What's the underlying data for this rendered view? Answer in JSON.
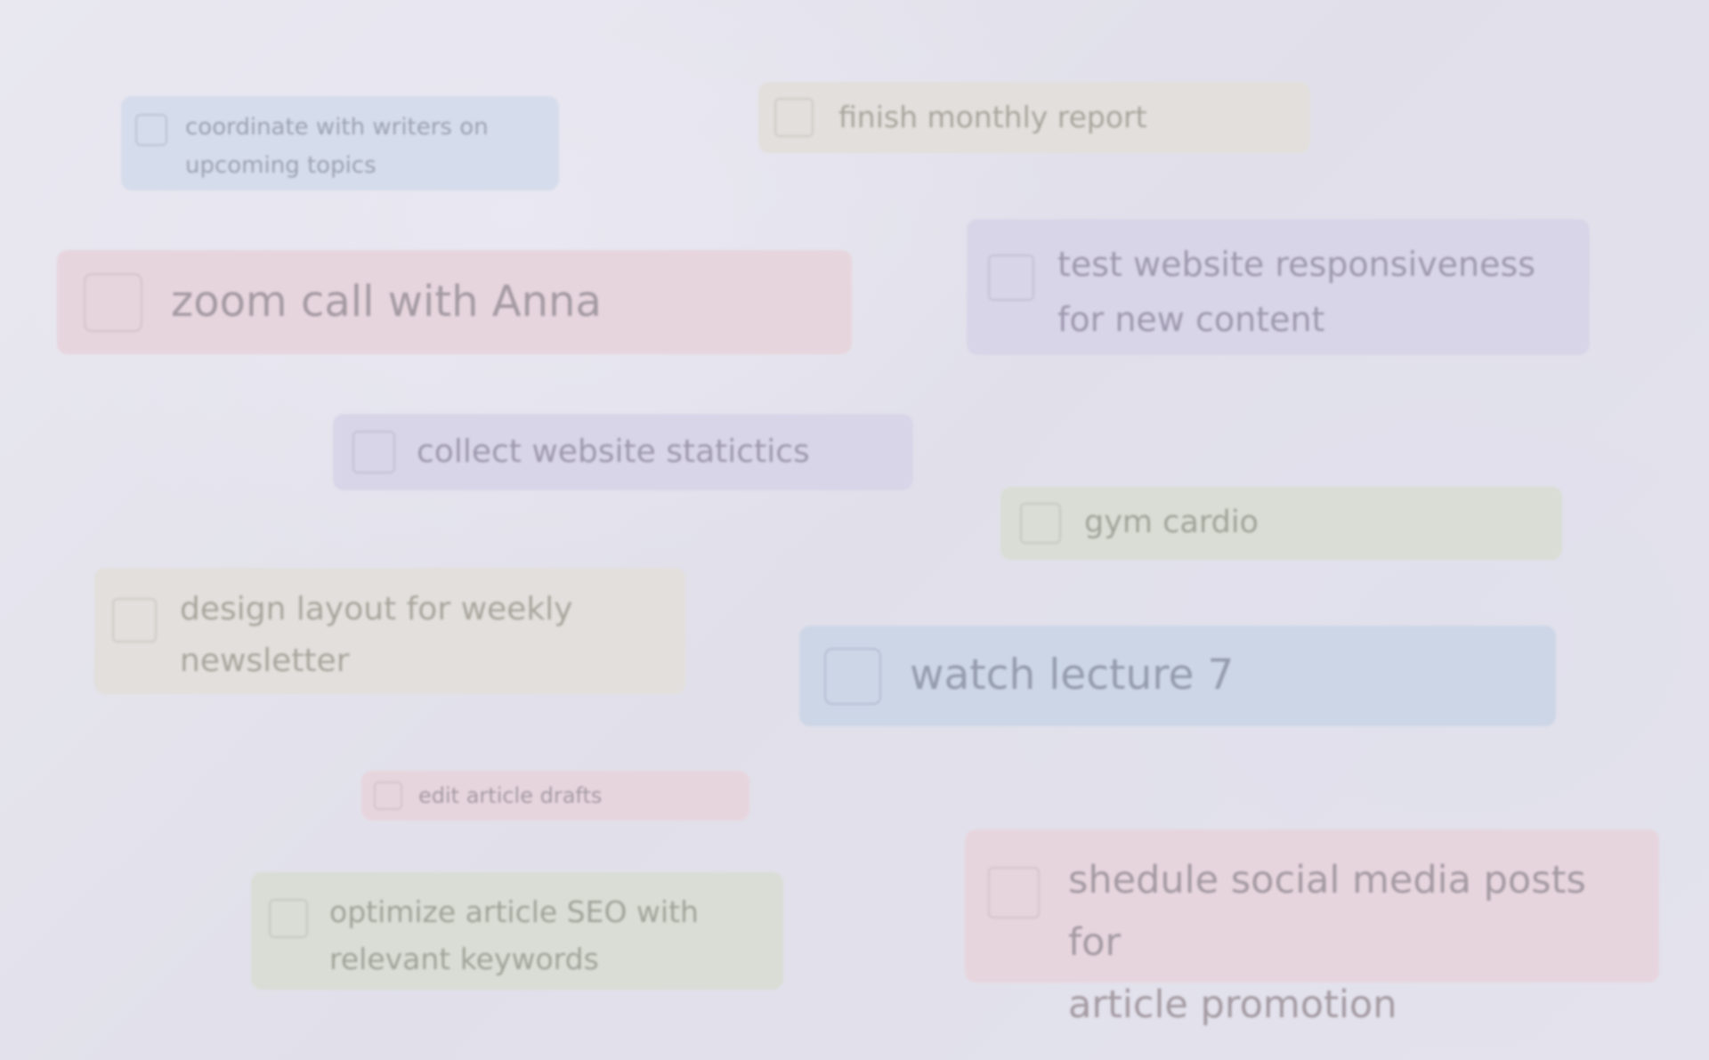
{
  "tasks": [
    {
      "id": "coordinate",
      "label": "coordinate with writers on\nupcoming topics",
      "color": "#d5dceb",
      "checked": false
    },
    {
      "id": "finish-report",
      "label": "finish monthly report",
      "color": "#e2dfdc",
      "checked": false
    },
    {
      "id": "zoom-call",
      "label": "zoom call with Anna",
      "color": "#e7d5dd",
      "checked": false
    },
    {
      "id": "test-website",
      "label": "test website responsiveness\nfor new content",
      "color": "#d9d5e8",
      "checked": false
    },
    {
      "id": "collect-stats",
      "label": "collect website statictics",
      "color": "#d9d5e8",
      "checked": false
    },
    {
      "id": "gym",
      "label": "gym cardio",
      "color": "#d9ddd5",
      "checked": false
    },
    {
      "id": "design-layout",
      "label": "design layout for weekly\nnewsletter",
      "color": "#e2dfdc",
      "checked": false
    },
    {
      "id": "watch-lecture",
      "label": "watch lecture 7",
      "color": "#cdd6e6",
      "checked": false
    },
    {
      "id": "edit-drafts",
      "label": "edit article drafts",
      "color": "#e7d5dd",
      "checked": false
    },
    {
      "id": "optimize-seo",
      "label": "optimize article SEO with\nrelevant keywords",
      "color": "#d9ddd5",
      "checked": false
    },
    {
      "id": "schedule-social",
      "label": "shedule social media posts for\narticle promotion",
      "color": "#e7d5dd",
      "checked": false
    }
  ]
}
